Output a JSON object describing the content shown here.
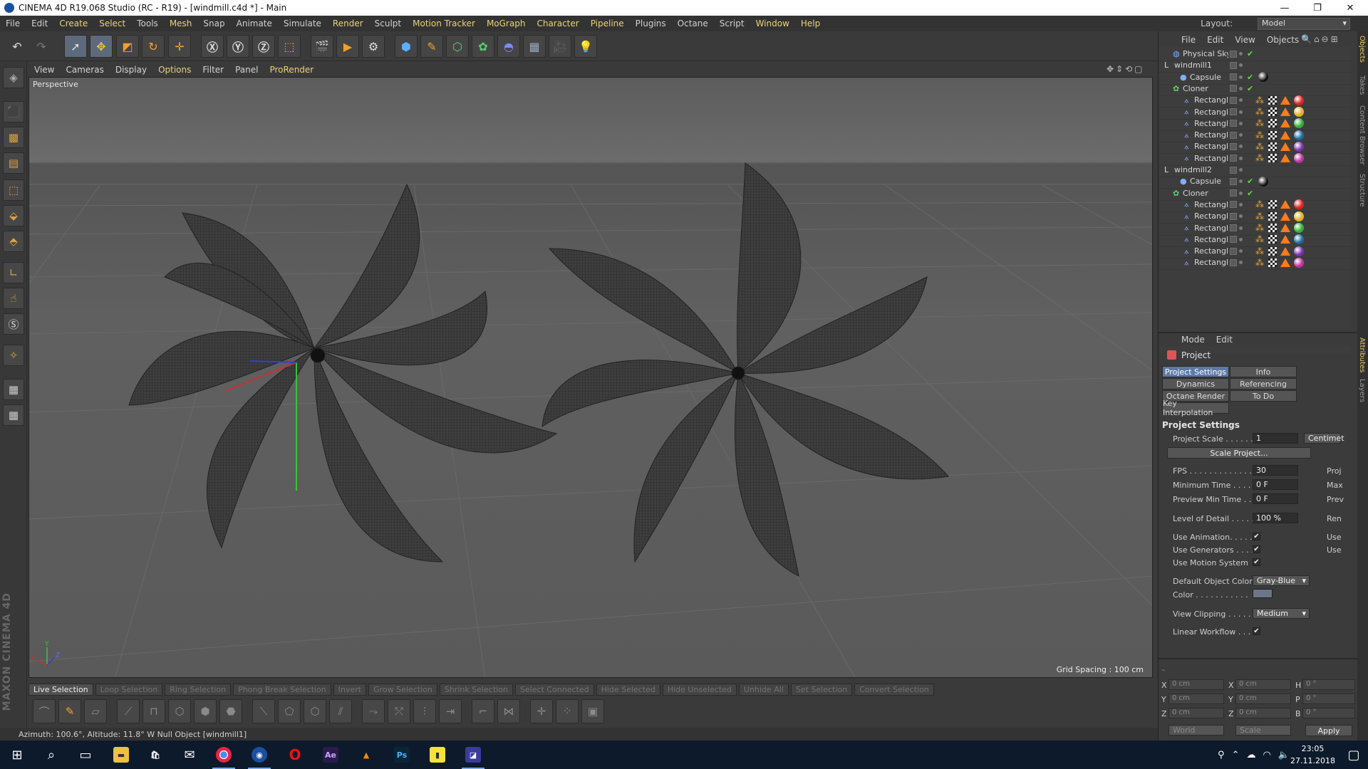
{
  "window": {
    "title": "CINEMA 4D R19.068 Studio (RC - R19) - [windmill.c4d *] - Main"
  },
  "menubar": {
    "items": [
      "File",
      "Edit",
      "Create",
      "Select",
      "Tools",
      "Mesh",
      "Snap",
      "Animate",
      "Simulate",
      "Render",
      "Sculpt",
      "Motion Tracker",
      "MoGraph",
      "Character",
      "Pipeline",
      "Plugins",
      "Octane",
      "Script",
      "Window",
      "Help"
    ]
  },
  "layout": {
    "label": "Layout:",
    "value": "Model"
  },
  "viewport": {
    "menu": [
      "View",
      "Cameras",
      "Display",
      "Options",
      "Filter",
      "Panel",
      "ProRender"
    ],
    "name": "Perspective",
    "grid_spacing": "Grid Spacing : 100 cm",
    "axis_labels": {
      "y": "Y",
      "x": "X",
      "z": "Z"
    }
  },
  "selection_bar": [
    "Live Selection",
    "Loop Selection",
    "Ring Selection",
    "Phong Break Selection",
    "Invert",
    "Grow Selection",
    "Shrink Selection",
    "Select Connected",
    "Hide Selected",
    "Hide Unselected",
    "Unhide All",
    "Set Selection",
    "Convert Selection"
  ],
  "status": {
    "text": "Azimuth: 100.6°, Altitude: 11.8°  W     Null Object [windmill1]"
  },
  "brand": "MAXON CINEMA 4D",
  "objects": {
    "menu": [
      "File",
      "Edit",
      "View",
      "Objects"
    ],
    "rows": [
      {
        "name": "Physical Sky"
      },
      {
        "name": "windmill1"
      },
      {
        "name": "Capsule"
      },
      {
        "name": "Cloner"
      },
      {
        "name": "Rectangle"
      },
      {
        "name": "Rectangle"
      },
      {
        "name": "Rectangle"
      },
      {
        "name": "Rectangle"
      },
      {
        "name": "Rectangle"
      },
      {
        "name": "Rectangle"
      },
      {
        "name": "windmill2"
      },
      {
        "name": "Capsule"
      },
      {
        "name": "Cloner"
      },
      {
        "name": "Rectangle"
      },
      {
        "name": "Rectangle"
      },
      {
        "name": "Rectangle"
      },
      {
        "name": "Rectangle"
      },
      {
        "name": "Rectangle"
      },
      {
        "name": "Rectangle"
      }
    ],
    "material_colors": [
      "#e02020",
      "#e0b020",
      "#30b030",
      "#1a6aa0",
      "#7a30b0",
      "#c030a0"
    ]
  },
  "attributes": {
    "menu": [
      "Mode",
      "Edit"
    ],
    "title": "Project",
    "tabs": [
      "Project Settings",
      "Info",
      "Dynamics",
      "Referencing",
      "Octane Render",
      "To Do",
      "Key Interpolation"
    ],
    "section": "Project Settings",
    "project_scale": {
      "label": "Project Scale . . . . . .",
      "value": "1",
      "unit": "Centimet"
    },
    "scale_button": "Scale Project...",
    "fps": {
      "label": "FPS . . . . . . . . . . . . . .",
      "value": "30",
      "right": "Proj"
    },
    "min_time": {
      "label": "Minimum Time . . . . . .",
      "value": "0 F",
      "right": "Max"
    },
    "preview_min": {
      "label": "Preview Min Time . .",
      "value": "0 F",
      "right": "Prev"
    },
    "lod": {
      "label": "Level of Detail . . . . . .",
      "value": "100 %",
      "right": "Ren"
    },
    "use_animation": {
      "label": "Use Animation. . . . .",
      "check": "✔",
      "right": "Use"
    },
    "use_generators": {
      "label": "Use Generators . . . .",
      "check": "✔",
      "right": "Use"
    },
    "use_motion": {
      "label": "Use Motion System",
      "check": "✔"
    },
    "default_color": {
      "label": "Default Object Color",
      "value": "Gray-Blue"
    },
    "color": {
      "label": "Color . . . . . . . . . . ."
    },
    "view_clipping": {
      "label": "View Clipping . . . . . .",
      "value": "Medium"
    },
    "linear_workflow": {
      "label": "Linear Workflow . . .",
      "check": "✔"
    }
  },
  "coords": {
    "labels_left": [
      "X",
      "Y",
      "Z"
    ],
    "labels_mid": [
      "X",
      "Y",
      "Z"
    ],
    "labels_right": [
      "H",
      "P",
      "B"
    ],
    "pos": [
      "0 cm",
      "0 cm",
      "0 cm"
    ],
    "size": [
      "0 cm",
      "0 cm",
      "0 cm"
    ],
    "rot": [
      "0 °",
      "0 °",
      "0 °"
    ],
    "dropdown1": "World",
    "dropdown2": "Scale",
    "apply": "Apply"
  },
  "side_tabs": [
    "Objects",
    "Takes",
    "Content Browser",
    "Structure",
    "Attributes",
    "Layers"
  ],
  "taskbar": {
    "time": "23:05",
    "date": "27.11.2018"
  }
}
